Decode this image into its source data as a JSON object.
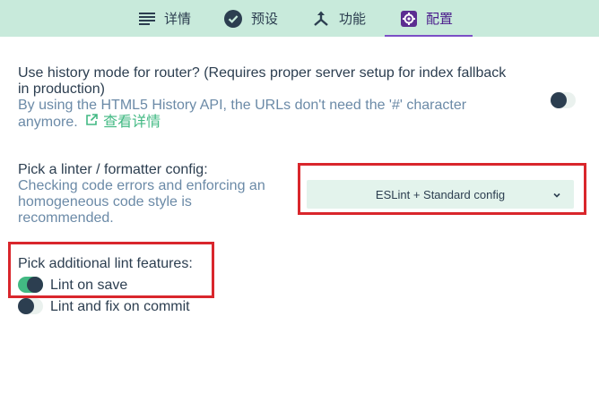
{
  "tabs": [
    {
      "label": "详情",
      "icon": "details-list-icon"
    },
    {
      "label": "预设",
      "icon": "check-circle-icon"
    },
    {
      "label": "功能",
      "icon": "features-fork-icon"
    },
    {
      "label": "配置",
      "icon": "config-gear-icon",
      "active": true
    }
  ],
  "history": {
    "question": "Use history mode for router? (Requires proper server setup for index fallback in production)",
    "description": "By using the HTML5 History API, the URLs don't need the '#' character anymore.",
    "link_label": "查看详情",
    "enabled": false
  },
  "linter": {
    "question": "Pick a linter / formatter config:",
    "description": "Checking code errors and enforcing an homogeneous code style is recommended.",
    "selected": "ESLint + Standard config"
  },
  "lint_features": {
    "question": "Pick additional lint features:",
    "options": [
      {
        "label": "Lint on save",
        "enabled": true
      },
      {
        "label": "Lint and fix on commit",
        "enabled": false
      }
    ]
  },
  "colors": {
    "topbar": "#c8eadb",
    "accent_green": "#42b983",
    "dark": "#2c3e50",
    "description": "#6b8aa7",
    "highlight_red": "#d9262c",
    "active_tab": "#4b1d8c"
  }
}
